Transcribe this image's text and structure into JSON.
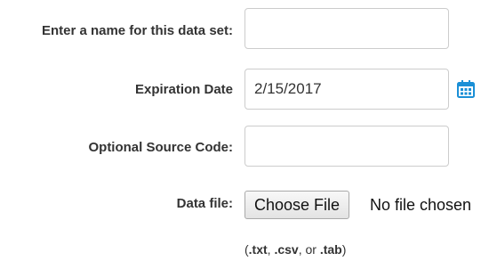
{
  "form": {
    "name_field": {
      "label": "Enter a name for this data set:",
      "value": "",
      "placeholder": ""
    },
    "expiration_field": {
      "label": "Expiration Date",
      "value": "2/15/2017",
      "icon": "calendar-icon",
      "icon_color": "#1a8fd6"
    },
    "source_code_field": {
      "label": "Optional Source Code:",
      "value": "",
      "placeholder": ""
    },
    "data_file": {
      "label": "Data file:",
      "button_label": "Choose File",
      "status_text": "No file chosen"
    },
    "file_hint": {
      "open": "(",
      "ext_txt": ".txt",
      "sep1": ", ",
      "ext_csv": ".csv",
      "sep2": ", or ",
      "ext_tab": ".tab",
      "close": ")"
    }
  }
}
